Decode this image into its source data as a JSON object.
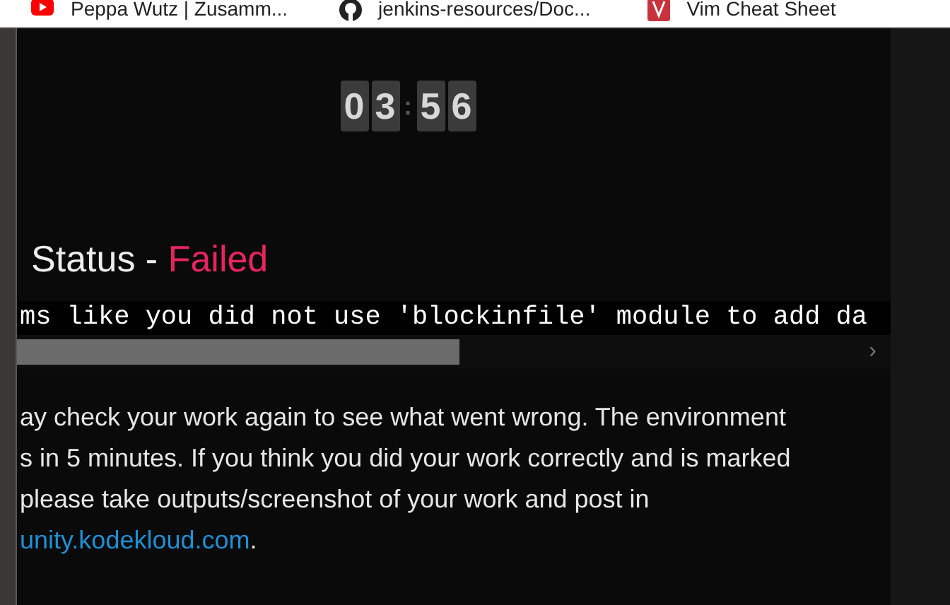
{
  "bookmarks": [
    {
      "kind": "youtube",
      "label": "Peppa Wutz | Zusamm..."
    },
    {
      "kind": "github",
      "label": "jenkins-resources/Doc..."
    },
    {
      "kind": "vim",
      "label": "Vim Cheat Sheet"
    }
  ],
  "timer": {
    "digits": [
      "0",
      "3",
      "5",
      "6"
    ],
    "separator": ":"
  },
  "status": {
    "label": "Status - ",
    "value": "Failed"
  },
  "message": "ms like you did not use 'blockinfile' module to add da",
  "scroll_arrow": "›",
  "paragraph": {
    "lines": [
      "ay check your work again to see what went wrong. The environment",
      "s in 5 minutes. If you think you did your work correctly and is marked",
      "please take outputs/screenshot of your work and post in"
    ],
    "link": "unity.kodekloud.com",
    "after_link": "."
  }
}
